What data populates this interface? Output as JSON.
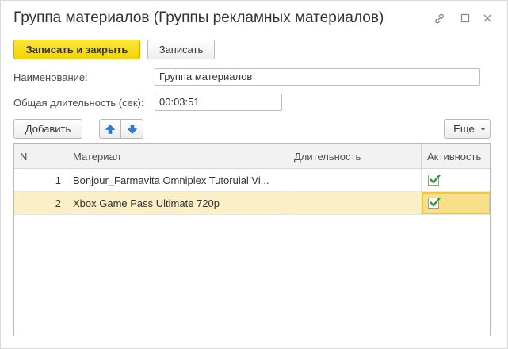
{
  "window": {
    "title": "Группа материалов (Группы рекламных материалов)",
    "link_icon": "link-icon",
    "maximize_icon": "maximize-icon",
    "close_icon": "close-icon"
  },
  "toolbar": {
    "save_close_label": "Записать и закрыть",
    "save_label": "Записать"
  },
  "form": {
    "name_label": "Наименование:",
    "name_value": "Группа материалов",
    "duration_label": "Общая  длительность (сек):",
    "duration_value": "00:03:51"
  },
  "table_toolbar": {
    "add_label": "Добавить",
    "move_up_icon": "arrow-up-icon",
    "move_down_icon": "arrow-down-icon",
    "more_label": "Еще"
  },
  "table": {
    "columns": [
      "N",
      "Материал",
      "Длительность",
      "Активность"
    ],
    "rows": [
      {
        "n": "1",
        "material": "Bonjour_Farmavita Omniplex Tutoruial Vi...",
        "duration": "",
        "active": true
      },
      {
        "n": "2",
        "material": "Xbox Game Pass Ultimate 720p",
        "duration": "",
        "active": true
      }
    ]
  },
  "colors": {
    "primary_button": "#f3d300",
    "selected_row": "#fbf0c5",
    "arrow_blue": "#2f7fd3",
    "check_green": "#2a9d3b"
  }
}
